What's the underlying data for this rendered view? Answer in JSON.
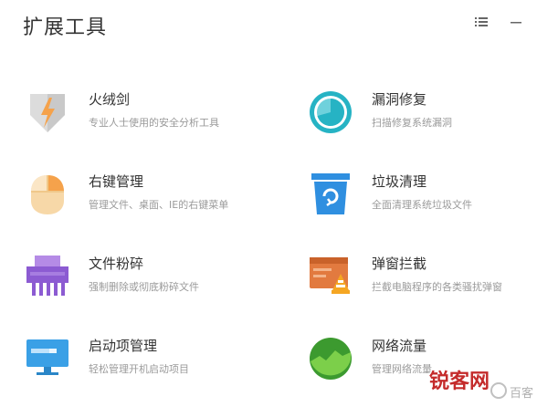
{
  "header": {
    "title": "扩展工具"
  },
  "tools": [
    {
      "name": "火绒剑",
      "desc": "专业人士使用的安全分析工具",
      "icon": "sword-shield-icon"
    },
    {
      "name": "漏洞修复",
      "desc": "扫描修复系统漏洞",
      "icon": "vulnerability-repair-icon"
    },
    {
      "name": "右键管理",
      "desc": "管理文件、桌面、IE的右键菜单",
      "icon": "mouse-icon"
    },
    {
      "name": "垃圾清理",
      "desc": "全面清理系统垃圾文件",
      "icon": "trash-bin-icon"
    },
    {
      "name": "文件粉碎",
      "desc": "强制删除或彻底粉碎文件",
      "icon": "file-shredder-icon"
    },
    {
      "name": "弹窗拦截",
      "desc": "拦截电脑程序的各类骚扰弹窗",
      "icon": "popup-block-icon"
    },
    {
      "name": "启动项管理",
      "desc": "轻松管理开机启动项目",
      "icon": "monitor-icon"
    },
    {
      "name": "网络流量",
      "desc": "管理网络流量",
      "icon": "network-traffic-icon"
    }
  ],
  "watermark": {
    "brand": "锐客网",
    "sub": "百客"
  },
  "colors": {
    "orange": "#f5a24b",
    "teal": "#26b3c4",
    "blue": "#2f8fe0",
    "purple": "#8c5bd2",
    "green": "#4cab3a"
  }
}
